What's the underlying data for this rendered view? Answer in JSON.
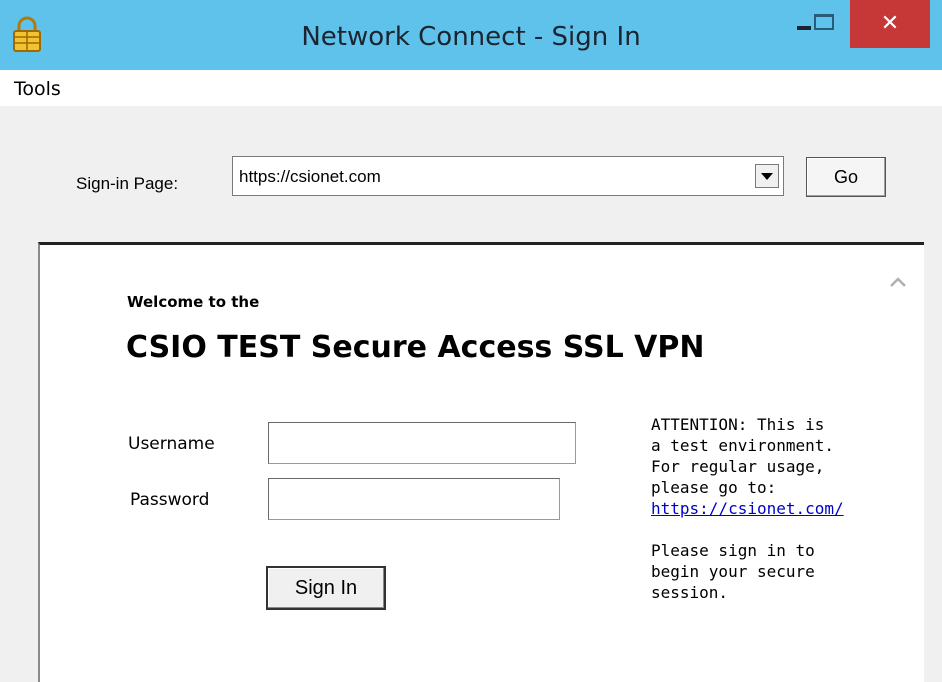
{
  "window": {
    "title": "Network Connect - Sign In",
    "close_symbol": "✕"
  },
  "menu": {
    "tools_label": "Tools"
  },
  "toolbar": {
    "signin_page_label": "Sign-in Page:",
    "signin_page_value": "https://csionet.com",
    "go_label": "Go"
  },
  "page": {
    "welcome_line": "Welcome to the",
    "heading": "CSIO TEST Secure Access SSL VPN",
    "username_label": "Username",
    "password_label": "Password",
    "username_value": "",
    "password_value": "",
    "signin_button_label": "Sign In",
    "notice_lines": [
      "ATTENTION: This is",
      "a test environment.",
      "For regular usage,",
      "please go to:"
    ],
    "notice_link": "https://csionet.com/",
    "signin_prompt_lines": [
      "Please sign in to",
      "begin your secure",
      "session."
    ]
  },
  "colors": {
    "titlebar": "#5ec2ea",
    "close_button": "#c63737",
    "link": "#0000cc"
  },
  "icons": {
    "app": "lock-icon",
    "scroll": "chevron-up-icon"
  }
}
